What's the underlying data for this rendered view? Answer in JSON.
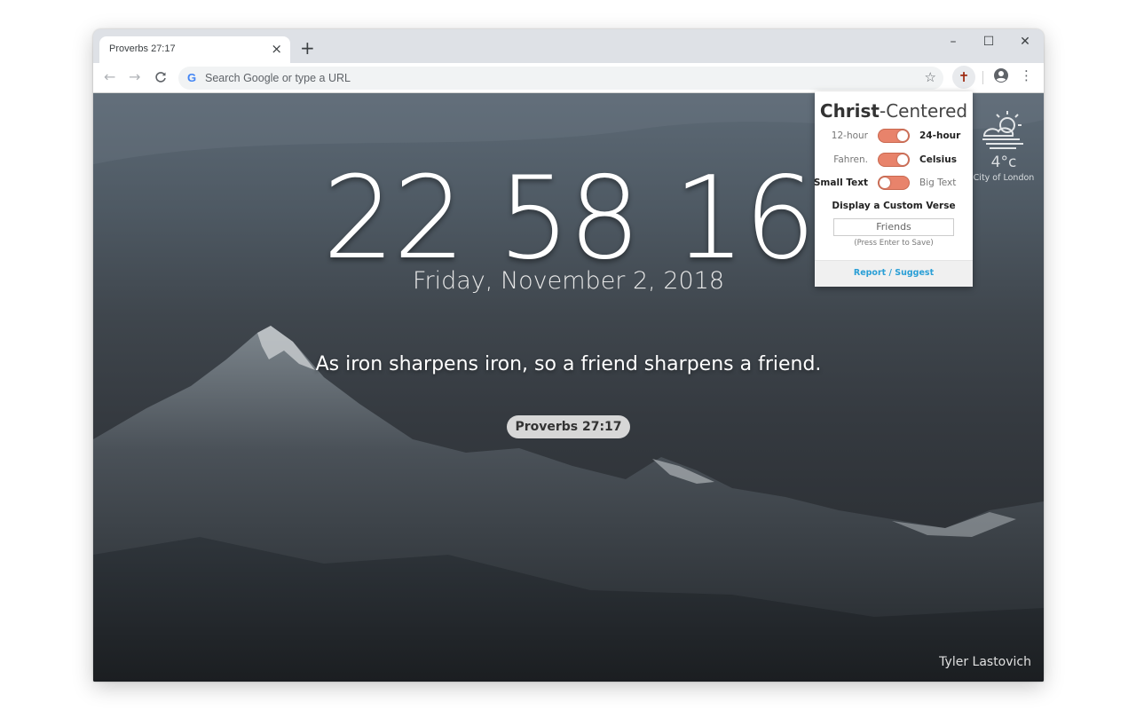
{
  "browser": {
    "tab_title": "Proverbs 27:17",
    "tab_close": "×",
    "new_tab": "+",
    "omnibox_placeholder": "Search Google or type a URL",
    "google_glyph": "G",
    "window_controls": {
      "minimize": "–",
      "maximize": "☐",
      "close": "✕"
    },
    "nav": {
      "back": "←",
      "forward": "→",
      "reload": "C"
    },
    "star": "☆",
    "extension_icon": "✝",
    "menu": "⋮"
  },
  "page": {
    "clock": {
      "hours": "22",
      "minutes": "58",
      "seconds": "16"
    },
    "date": "Friday, November 2, 2018",
    "verse_text": "As iron sharpens iron, so a friend sharpens a friend.",
    "verse_ref": "Proverbs 27:17",
    "weather": {
      "temperature": "4°c",
      "location": "City of London",
      "icon": "partly-sunny-fog-icon"
    },
    "photo_credit": "Tyler Lastovich"
  },
  "popup": {
    "brand_bold": "Christ",
    "brand_rest": "-Centered",
    "toggles": [
      {
        "left": "12-hour",
        "right": "24-hour",
        "state": "right"
      },
      {
        "left": "Fahren.",
        "right": "Celsius",
        "state": "right"
      },
      {
        "left": "Small Text",
        "right": "Big Text",
        "state": "left"
      }
    ],
    "custom_verse_title": "Display a Custom Verse",
    "custom_verse_value": "Friends",
    "custom_verse_hint": "(Press Enter to Save)",
    "report_link": "Report / Suggest"
  },
  "colors": {
    "toggle_accent": "#e8836b",
    "link": "#2a9fd6",
    "extension_icon": "#9e2a12"
  }
}
